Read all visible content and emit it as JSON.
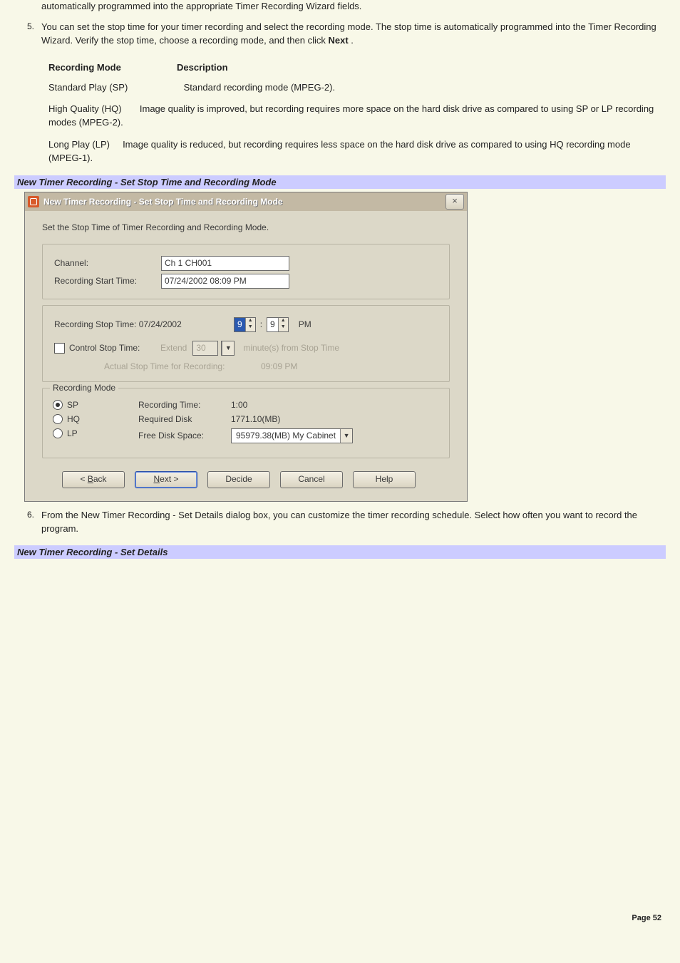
{
  "doc": {
    "lead": "automatically programmed into the appropriate Timer Recording Wizard fields.",
    "step5_num": "5.",
    "step5_a": "You can set the stop time for your timer recording and select the recording mode. The stop time is automatically programmed into the Timer Recording Wizard. Verify the stop time, choose a recording mode, and then click ",
    "step5_b": "Next",
    "step5_c": " .",
    "th1": "Recording Mode",
    "th2": "Description",
    "modes": [
      {
        "name": "Standard Play (SP)",
        "desc": "Standard recording mode (MPEG-2)."
      },
      {
        "name": "High Quality (HQ)",
        "desc": "Image quality is improved, but recording requires more space on the hard disk drive as compared to using SP or LP recording modes (MPEG-2)."
      },
      {
        "name": "Long Play (LP)",
        "desc": "Image quality is reduced, but recording requires less space on the hard disk drive as compared to using HQ recording mode (MPEG-1)."
      }
    ],
    "subhead1": "New Timer Recording - Set Stop Time and Recording Mode",
    "step6_num": "6.",
    "step6": "From the New Timer Recording - Set Details dialog box, you can customize the timer recording schedule. Select how often you want to record the program.",
    "subhead2": "New Timer Recording - Set Details",
    "pagenum": "Page 52"
  },
  "dlg": {
    "title": "New Timer Recording - Set Stop Time and Recording Mode",
    "close": "×",
    "instr": "Set the Stop Time of Timer Recording and Recording Mode.",
    "channel_lbl": "Channel:",
    "channel_val": "Ch 1 CH001",
    "start_lbl": "Recording Start Time:",
    "start_val": "07/24/2002 08:09 PM",
    "stop_lbl": "Recording Stop Time: 07/24/2002",
    "stop_h": "9",
    "stop_sep": ":",
    "stop_m": "9",
    "stop_ampm": "PM",
    "ctrl_lbl": "Control Stop Time:",
    "extend": "Extend",
    "extend_val": "30",
    "extend_tail": "minute(s) from Stop Time",
    "actual_lbl": "Actual Stop Time for Recording:",
    "actual_val": "09:09 PM",
    "rec_mode": "Recording Mode",
    "sp": "SP",
    "hq": "HQ",
    "lp": "LP",
    "rt_lbl": "Recording Time:",
    "rt_val": "1:00",
    "rd_lbl": "Required Disk",
    "rd_val": "1771.10(MB)",
    "fd_lbl": "Free Disk Space:",
    "fd_val": "95979.38(MB) My Cabinet",
    "btn_back": "< Back",
    "btn_next": "Next >",
    "btn_decide": "Decide",
    "btn_cancel": "Cancel",
    "btn_help": "Help"
  }
}
